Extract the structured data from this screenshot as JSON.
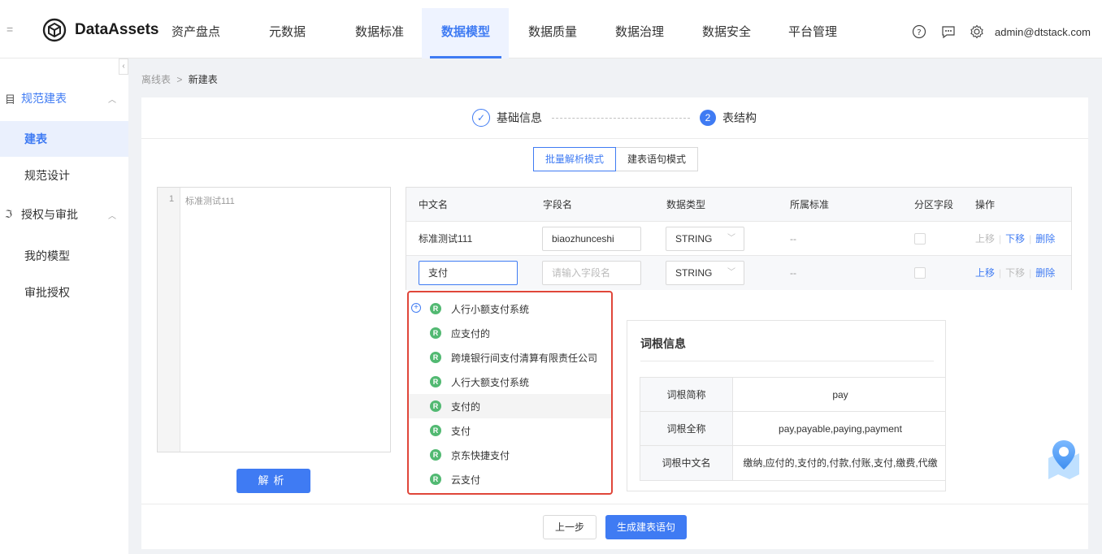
{
  "app": {
    "brand": "DataAssets",
    "user": "admin@dtstack.com"
  },
  "nav": [
    "资产盘点",
    "元数据",
    "数据标准",
    "数据模型",
    "数据质量",
    "数据治理",
    "数据安全",
    "平台管理"
  ],
  "sidebar": {
    "collapse_icon": "chevron-left-icon",
    "groups": [
      {
        "label": "规范建表",
        "items": [
          "建表",
          "规范设计"
        ]
      },
      {
        "label": "授权与审批",
        "items": [
          "我的模型",
          "审批授权"
        ]
      }
    ]
  },
  "breadcrumb": {
    "parent": "离线表",
    "separator": ">",
    "current": "新建表"
  },
  "steps": {
    "step1": "基础信息",
    "step2_num": "2",
    "step2": "表结构"
  },
  "modes": [
    "批量解析模式",
    "建表语句模式"
  ],
  "editor": {
    "line_no": "1",
    "content": "标准测试111"
  },
  "parse_button": "解析",
  "table": {
    "headers": [
      "中文名",
      "字段名",
      "数据类型",
      "所属标准",
      "分区字段",
      "操作"
    ],
    "rows": [
      {
        "cn": "标准测试111",
        "field": "biaozhunceshi",
        "type": "STRING",
        "std": "--",
        "ops": [
          "上移",
          "下移",
          "删除"
        ]
      },
      {
        "cn": "支付",
        "field_placeholder": "请输入字段名",
        "type": "STRING",
        "std": "--",
        "ops": [
          "上移",
          "下移",
          "删除"
        ]
      }
    ]
  },
  "dropdown": {
    "badge": "R",
    "items": [
      "人行小额支付系统",
      "应支付的",
      "跨境银行间支付清算有限责任公司",
      "人行大额支付系统",
      "支付的",
      "支付",
      "京东快捷支付",
      "云支付"
    ]
  },
  "root_info": {
    "title": "词根信息",
    "rows": [
      {
        "key": "词根简称",
        "value": "pay"
      },
      {
        "key": "词根全称",
        "value": "pay,payable,paying,payment"
      },
      {
        "key": "词根中文名",
        "value": "缴纳,应付的,支付的,付款,付账,支付,缴费,代缴"
      }
    ]
  },
  "footer": {
    "prev": "上一步",
    "generate": "生成建表语句"
  },
  "colors": {
    "primary": "#3f7bf3",
    "badge_green": "#52b972",
    "highlight_red": "#e0463a"
  }
}
